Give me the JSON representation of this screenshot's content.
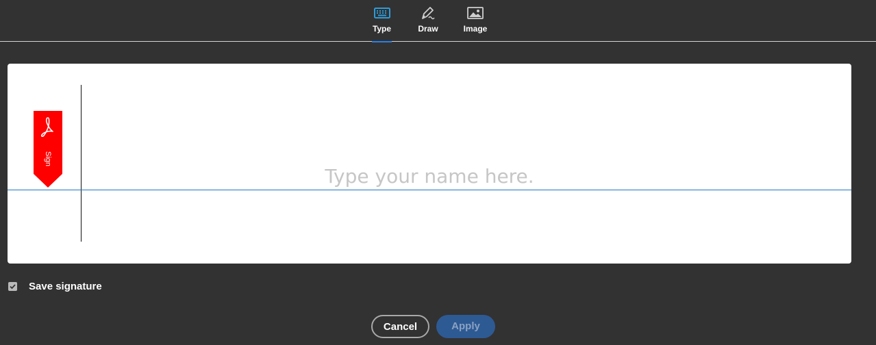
{
  "tabs": [
    {
      "label": "Type",
      "icon": "keyboard-icon",
      "active": true
    },
    {
      "label": "Draw",
      "icon": "pen-icon",
      "active": false
    },
    {
      "label": "Image",
      "icon": "image-icon",
      "active": false
    }
  ],
  "signature": {
    "placeholder": "Type your name here.",
    "value": "",
    "badge_label": "Sign",
    "badge_icon": "acrobat-logo-icon"
  },
  "save_signature": {
    "label": "Save signature",
    "checked": true
  },
  "buttons": {
    "cancel": "Cancel",
    "apply": "Apply"
  },
  "colors": {
    "background": "#323232",
    "accent": "#2680eb",
    "badge": "#ff0000",
    "apply_button": "#2e5a93",
    "baseline": "#1f78c1"
  }
}
